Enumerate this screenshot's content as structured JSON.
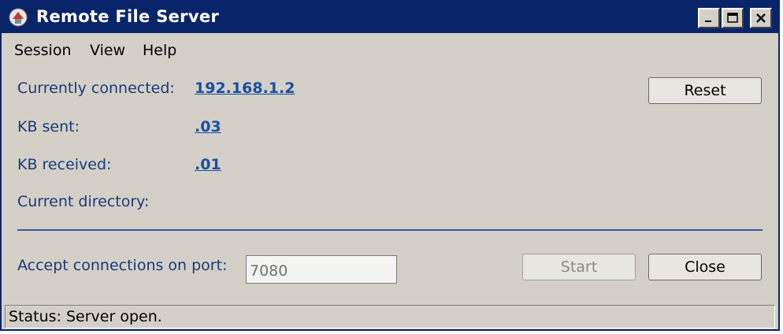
{
  "window": {
    "title": "Remote File Server",
    "minimize_label": "_",
    "maximize_label": "□",
    "close_label": "✕"
  },
  "menu": {
    "items": [
      "Session",
      "View",
      "Help"
    ]
  },
  "info": {
    "connected_label": "Currently connected:",
    "connected_value": "192.168.1.2",
    "kb_sent_label": "KB sent:",
    "kb_sent_value": ".03",
    "kb_received_label": "KB received:",
    "kb_received_value": ".01",
    "directory_label": "Current directory:"
  },
  "buttons": {
    "reset": "Reset",
    "start": "Start",
    "close": "Close"
  },
  "port": {
    "label": "Accept connections on port:",
    "value": "7080"
  },
  "status": {
    "text": "Status: Server open."
  },
  "colors": {
    "titlebar": "#0a246a",
    "window_bg": "#d4d0c8",
    "label_text": "#1a3a7a",
    "link_text": "#1a4fa0"
  },
  "icons": {
    "app": "remote-file-server-icon"
  }
}
